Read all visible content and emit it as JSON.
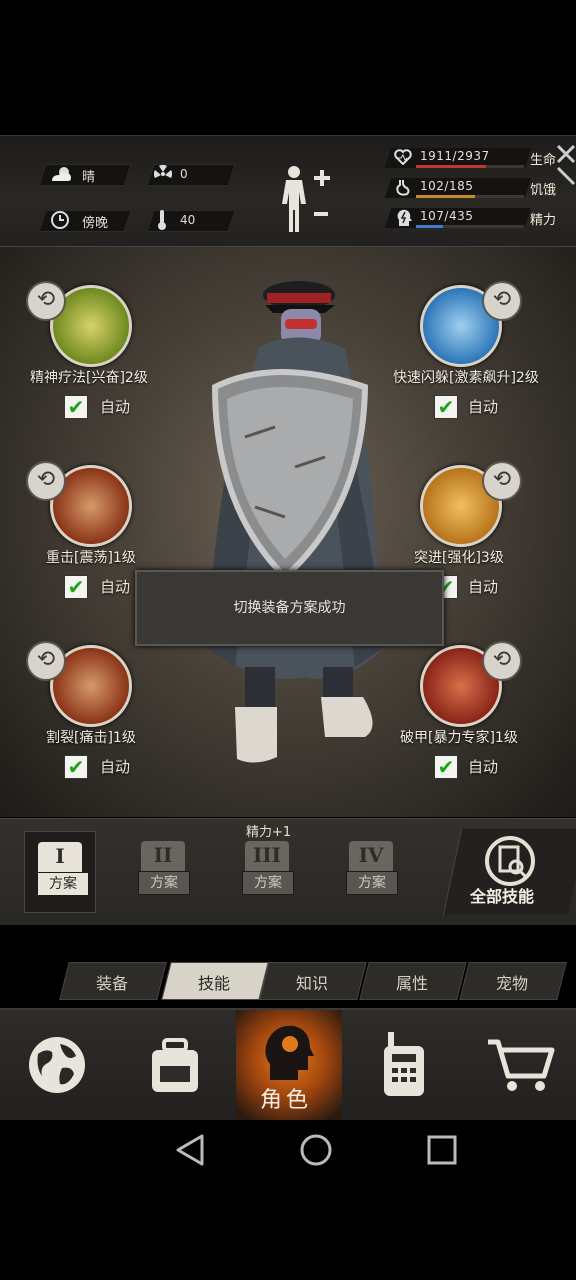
{
  "weather": {
    "condition": "晴",
    "radiation": "0",
    "time_of_day": "傍晚",
    "temperature": "40"
  },
  "stats": [
    {
      "label": "生命",
      "value": "1911/2937",
      "ratio": 0.65,
      "color": "#c0392b"
    },
    {
      "label": "饥饿",
      "value": "102/185",
      "ratio": 0.55,
      "color": "#c98a2c"
    },
    {
      "label": "精力",
      "value": "107/435",
      "ratio": 0.25,
      "color": "#3d7fc4"
    }
  ],
  "skills": [
    {
      "name": "精神疗法[兴奋]2级",
      "auto": "自动"
    },
    {
      "name": "快速闪躲[激素飙升]2级",
      "auto": "自动"
    },
    {
      "name": "重击[震荡]1级",
      "auto": "自动"
    },
    {
      "name": "突进[强化]3级",
      "auto": "自动"
    },
    {
      "name": "割裂[痛击]1级",
      "auto": "自动"
    },
    {
      "name": "破甲[暴力专家]1级",
      "auto": "自动"
    }
  ],
  "toast": "切换装备方案成功",
  "plan_bonus": "精力+1",
  "plans": [
    {
      "roman": "I",
      "label": "方案"
    },
    {
      "roman": "II",
      "label": "方案"
    },
    {
      "roman": "III",
      "label": "方案"
    },
    {
      "roman": "IV",
      "label": "方案"
    }
  ],
  "all_skills": "全部技能",
  "tabs": [
    "装备",
    "技能",
    "知识",
    "属性",
    "宠物"
  ],
  "active_tab": "技能",
  "nav": {
    "character": "角色"
  }
}
